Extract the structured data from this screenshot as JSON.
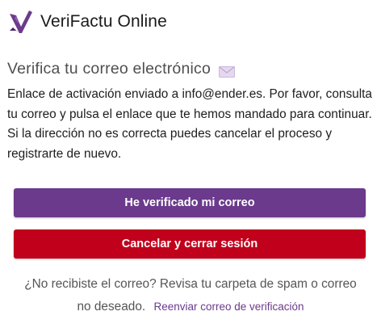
{
  "header": {
    "app_title": "VeriFactu Online",
    "logo_icon": "verifactu-v-logo",
    "brand_color": "#6b3a8c"
  },
  "verification": {
    "title": "Verifica tu correo electrónico",
    "title_icon": "envelope-icon",
    "message": "Enlace de activación enviado a info@ender.es. Por favor, consulta tu correo y pulsa el enlace que te hemos mandado para continuar. Si la dirección no es correcta puedes cancelar el proceso y registrarte de nuevo."
  },
  "buttons": {
    "verified_label": "He verificado mi correo",
    "verified_color": "#6b3a8c",
    "cancel_label": "Cancelar y cerrar sesión",
    "cancel_color": "#c1001b"
  },
  "help": {
    "text": "¿No recibiste el correo? Revisa tu carpeta de spam o correo no deseado.",
    "resend_link": "Reenviar correo de verificación"
  }
}
